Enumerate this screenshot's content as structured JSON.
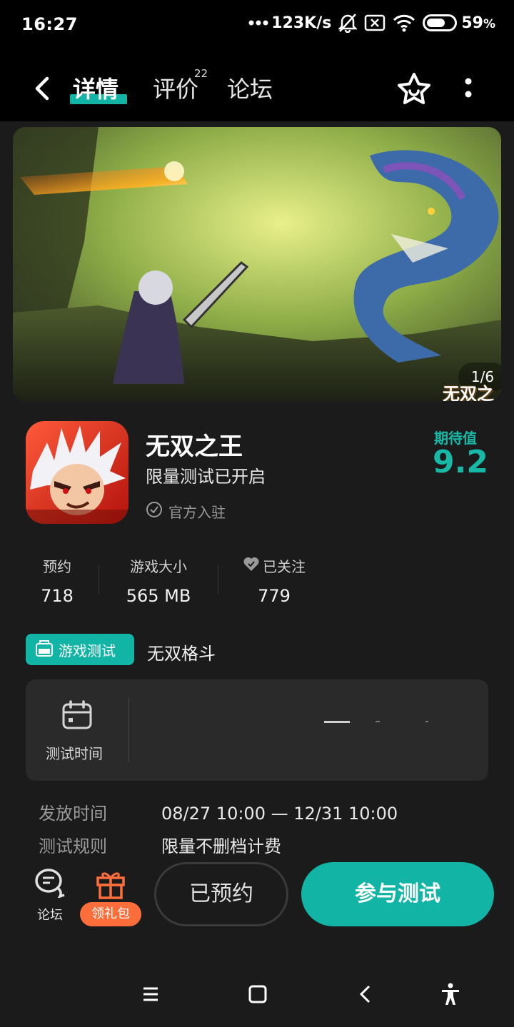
{
  "status_bar": {
    "time": "16:27",
    "network_speed": "123K/s",
    "battery": "59",
    "battery_unit": "%",
    "icons": [
      "dots-icon",
      "bell-muted-icon",
      "sim-off-icon",
      "wifi-icon",
      "battery-icon"
    ]
  },
  "nav": {
    "tabs": [
      {
        "label": "详情",
        "active": true
      },
      {
        "label": "评价",
        "badge": "22"
      },
      {
        "label": "论坛"
      }
    ],
    "back_icon": "back-arrow-icon",
    "favorite_icon": "star-icon",
    "more_icon": "more-vertical-icon"
  },
  "banner": {
    "counter": "1/6",
    "logo_text": "无双之王"
  },
  "app": {
    "name": "无双之王",
    "subtitle": "限量测试已开启",
    "official": "官方入驻",
    "expect_label": "期待值",
    "expect_score": "9.2"
  },
  "stats": [
    {
      "label": "预约",
      "value": "718"
    },
    {
      "label": "游戏大小",
      "value": "565 MB"
    },
    {
      "label": "已关注",
      "value": "779"
    }
  ],
  "test": {
    "badge": "游戏测试",
    "name": "无双格斗",
    "card_label": "测试时间"
  },
  "info": [
    {
      "key": "发放时间",
      "value": "08/27 10:00 — 12/31 10:00"
    },
    {
      "key": "测试规则",
      "value": "限量不删档计费"
    }
  ],
  "actions": {
    "forum": "论坛",
    "gift": "领礼包",
    "reserved": "已预约",
    "join": "参与测试"
  },
  "colors": {
    "accent": "#12b5a5",
    "gift": "#ff6d3a",
    "background": "#1b1b1b"
  }
}
